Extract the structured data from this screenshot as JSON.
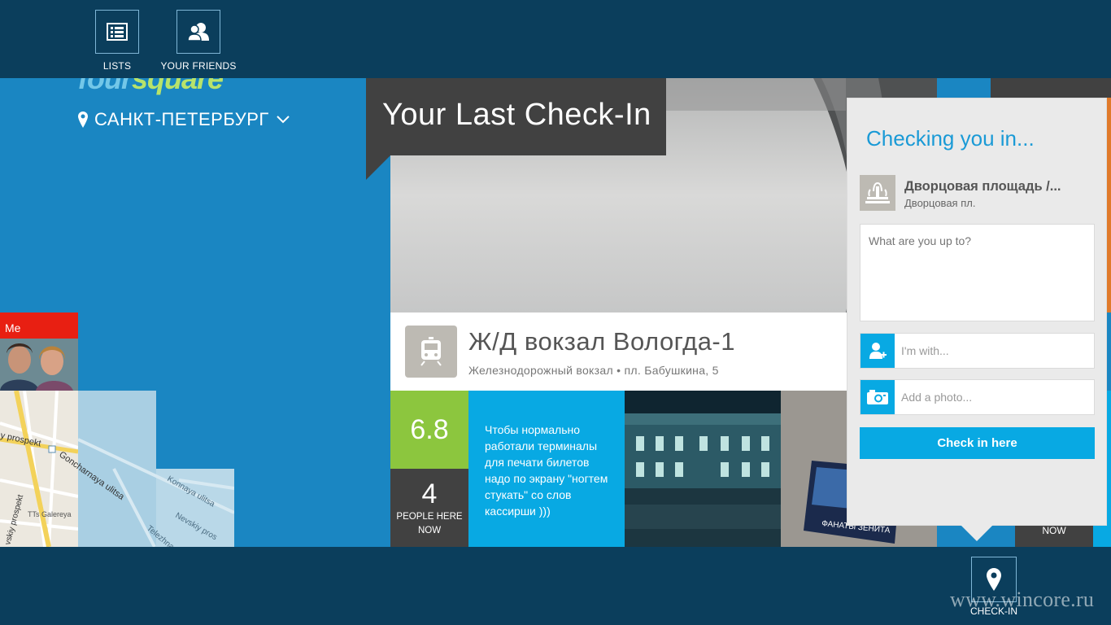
{
  "topbar": {
    "lists_label": "LISTS",
    "friends_label": "YOUR FRIENDS"
  },
  "brand": {
    "logo_text_a": "four",
    "logo_text_b": "square"
  },
  "location": {
    "city": "САНКТ-ПЕТЕРБУРГ"
  },
  "me_tile": {
    "label": "Me"
  },
  "last_checkin": {
    "header": "Your Last Check-In",
    "venue_name": "Ж/Д вокзал Вологда-1",
    "venue_address": "Железнодорожный вокзал • пл. Бабушкина, 5",
    "score": "6.8",
    "people_count": "4",
    "people_label": "PEOPLE HERE NOW",
    "tip": "Чтобы нормально работали терминалы для печати билетов надо по экрану \"ногтем стукать\" со слов кассирши )))"
  },
  "behind_tiles": {
    "now_label": "NOW"
  },
  "flyout": {
    "title": "Checking you in...",
    "venue_name": "Дворцовая площадь /...",
    "venue_address": "Дворцовая пл.",
    "comment_placeholder": "What are you up to?",
    "with_placeholder": "I'm with...",
    "photo_placeholder": "Add a photo...",
    "checkin_button": "Check in here"
  },
  "bottombar": {
    "checkin_label": "CHECK-IN",
    "watermark": "www.wincore.ru"
  },
  "colors": {
    "appbar": "#0b3e5c",
    "background": "#1a86c2",
    "accent": "#08a9e3",
    "score_green": "#8cc63e",
    "dark_tile": "#414141",
    "me_red": "#e81f12"
  },
  "map_labels": {
    "street1": "y prospekt",
    "street2": "Goncharnaya ulitsa",
    "street3": "Konnaya ulitsa",
    "street4": "Nevskiy pros",
    "street5": "Telezhnaya",
    "street6": "vskiy prospekt",
    "poi": "TTs Galereya"
  }
}
